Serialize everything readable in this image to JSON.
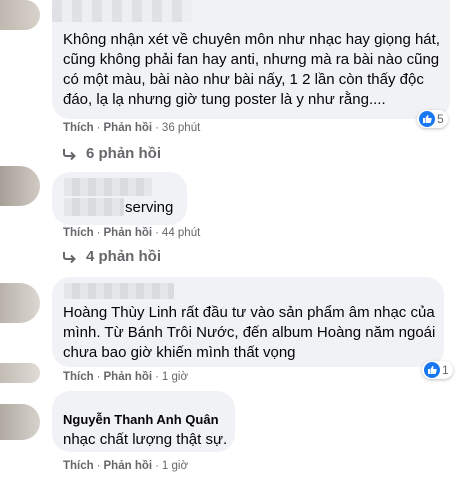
{
  "comments": [
    {
      "text": "Không nhận xét về chuyên môn như nhạc hay giọng hát, cũng không phải fan hay anti, nhưng mà ra bài nào cũng có một màu, bài nào như bài nấy, 1 2 lần còn thấy độc đáo, lạ lạ nhưng giờ tung poster là y như rằng....",
      "like_label": "Thích",
      "reply_label": "Phản hồi",
      "time": "36 phút",
      "reaction_count": "5",
      "replies_label": "6 phản hồi"
    },
    {
      "text": "serving",
      "like_label": "Thích",
      "reply_label": "Phản hồi",
      "time": "44 phút",
      "replies_label": "4 phản hồi"
    },
    {
      "text": "Hoàng Thùy Linh rất đầu tư vào sản phẩm âm nhạc của mình. Từ Bánh Trôi Nước, đến album Hoàng năm ngoái chưa bao giờ khiến mình thất vọng",
      "like_label": "Thích",
      "reply_label": "Phản hồi",
      "time": "1 giờ",
      "reaction_count": "1"
    },
    {
      "author": "Nguyễn Thanh Anh Quân",
      "text": "nhạc chất lượng thật sự.",
      "like_label": "Thích",
      "reply_label": "Phản hồi",
      "time": "1 giờ"
    }
  ],
  "colors": {
    "bubble": "#f0f2f5",
    "secondary_text": "#65676b",
    "like_blue": "#1877f2"
  }
}
